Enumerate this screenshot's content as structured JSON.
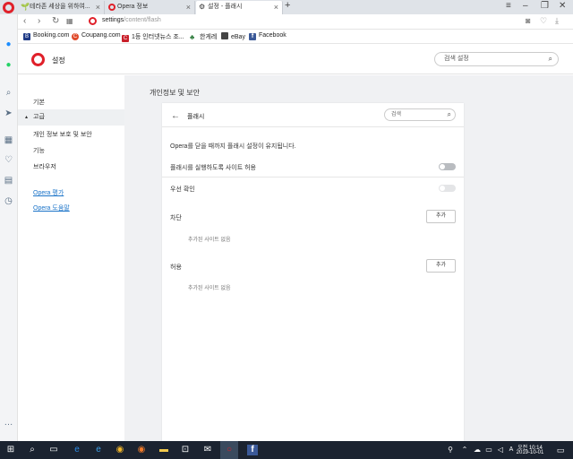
{
  "tabs": [
    {
      "label": "테라존 세상을 위하여..."
    },
    {
      "label": "Opera 정보"
    },
    {
      "label": "설정 - 플래시"
    }
  ],
  "address": {
    "host": "settings",
    "path": "/content/flash"
  },
  "bookmarks": [
    {
      "label": "Booking.com",
      "color": "#1f3b86",
      "letter": "B"
    },
    {
      "label": "Coupang.com",
      "color": "#e04a2b",
      "letter": "C"
    },
    {
      "label": "1등 인터넷뉴스 조...",
      "color": "#c91f2a",
      "letter": "C"
    },
    {
      "label": "한게레",
      "color": "#2c7a3a",
      "letter": "♣"
    },
    {
      "label": "eBay",
      "color": "#444444",
      "letter": "◼"
    },
    {
      "label": "Facebook",
      "color": "#3b5998",
      "letter": "f"
    }
  ],
  "settings": {
    "title": "설정",
    "search_placeholder": "검색 설정"
  },
  "nav": {
    "basic": "기본",
    "advanced": "고급",
    "privacy": "개인 정보 보호 및 보안",
    "features": "기능",
    "browser": "브라우저",
    "link_rate": "Opera 평가",
    "link_help": "Opera 도움말"
  },
  "main": {
    "section_title": "개인정보 및 보안",
    "card": {
      "title": "플래시",
      "search_placeholder": "검색",
      "info": "Opera를 닫을 때까지 플래시 설정이 유지됩니다.",
      "allow_sites_label": "플래시를 실행하도록 사이트 허용",
      "ask_first_label": "우선 확인",
      "block_label": "차단",
      "block_add": "추가",
      "block_empty": "추가된 사이트 없음",
      "allow_label": "허용",
      "allow_add": "추가",
      "allow_empty": "추가된 사이트 없음",
      "allow_sites_enabled": false,
      "ask_first_enabled": false
    }
  },
  "taskbar": {
    "time": "오전 10:14",
    "date": "2019-10-01"
  },
  "colors": {
    "opera_red": "#e0202a",
    "link_blue": "#1a73c8",
    "taskbar": "#1b2330"
  }
}
